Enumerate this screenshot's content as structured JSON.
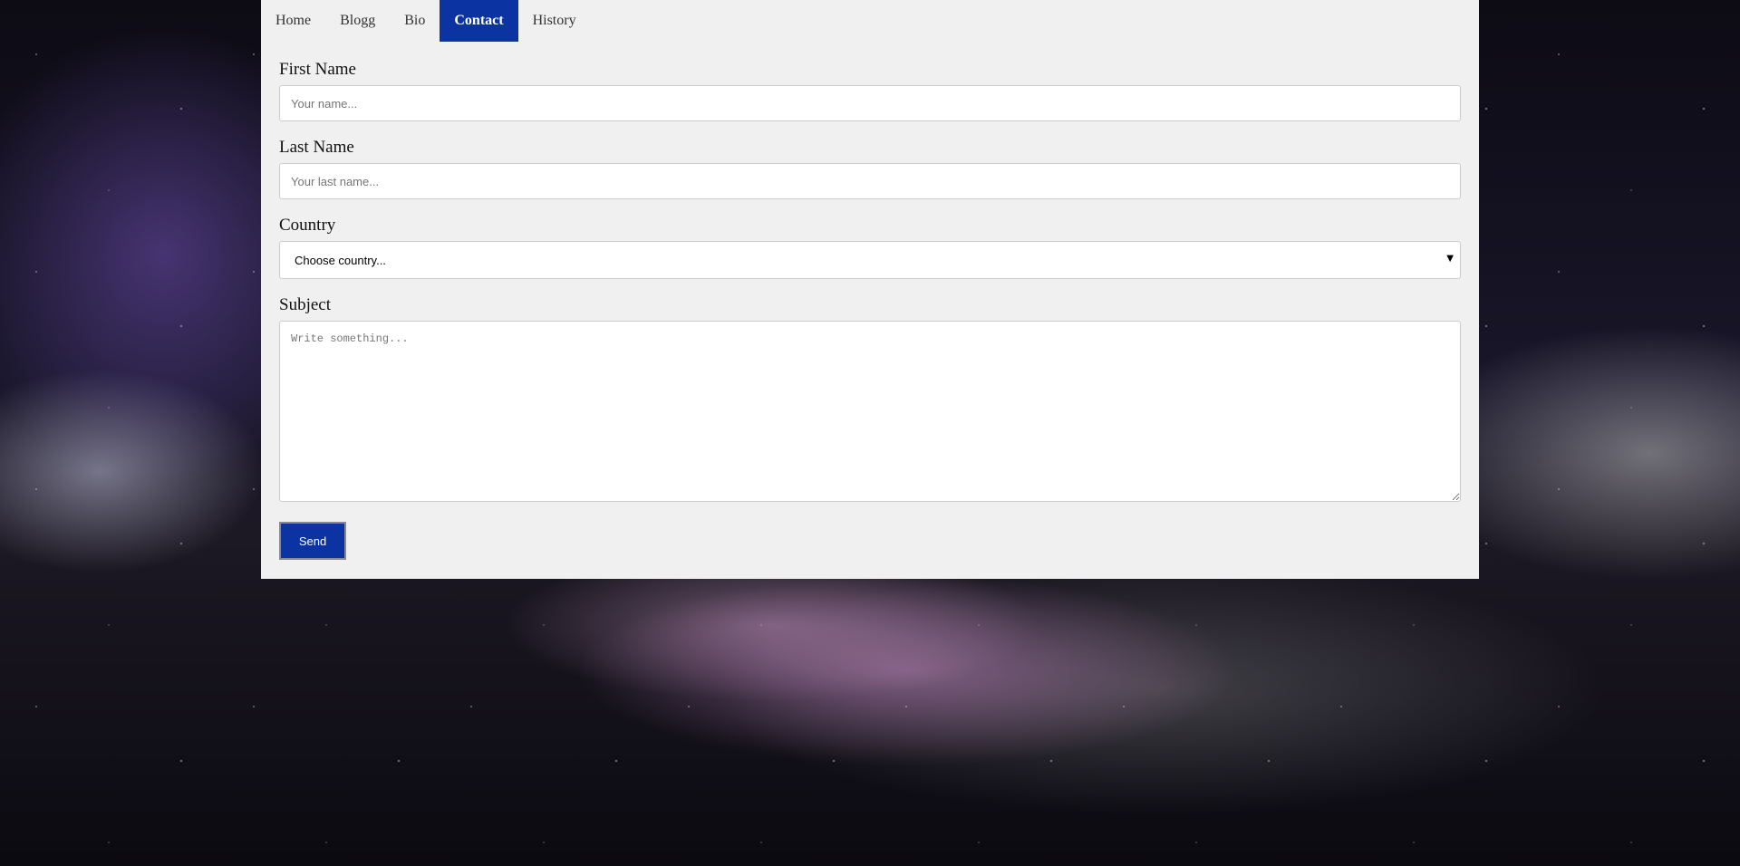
{
  "nav": {
    "items": [
      {
        "label": "Home",
        "active": false
      },
      {
        "label": "Blogg",
        "active": false
      },
      {
        "label": "Bio",
        "active": false
      },
      {
        "label": "Contact",
        "active": true
      },
      {
        "label": "History",
        "active": false
      }
    ]
  },
  "form": {
    "first_name_label": "First Name",
    "first_name_placeholder": "Your name...",
    "last_name_label": "Last Name",
    "last_name_placeholder": "Your last name...",
    "country_label": "Country",
    "country_selected": "Choose country...",
    "subject_label": "Subject",
    "subject_placeholder": "Write something...",
    "send_label": "Send"
  },
  "colors": {
    "accent": "#0b34a2",
    "panel_bg": "#f0f0f0"
  }
}
